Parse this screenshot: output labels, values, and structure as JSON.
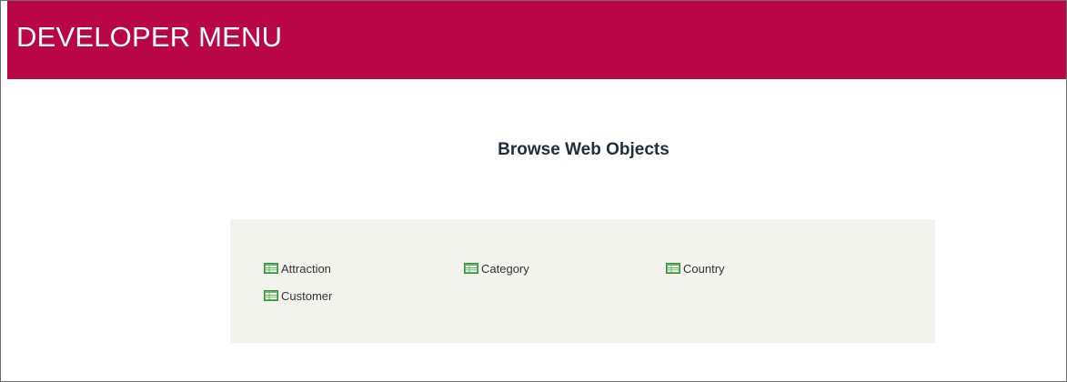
{
  "header": {
    "title": "DEVELOPER MENU",
    "background": "#b90647"
  },
  "main": {
    "heading": "Browse Web Objects"
  },
  "objects": {
    "icon": "table-icon",
    "items": [
      {
        "label": "Attraction"
      },
      {
        "label": "Category"
      },
      {
        "label": "Country"
      },
      {
        "label": "Customer"
      }
    ]
  }
}
